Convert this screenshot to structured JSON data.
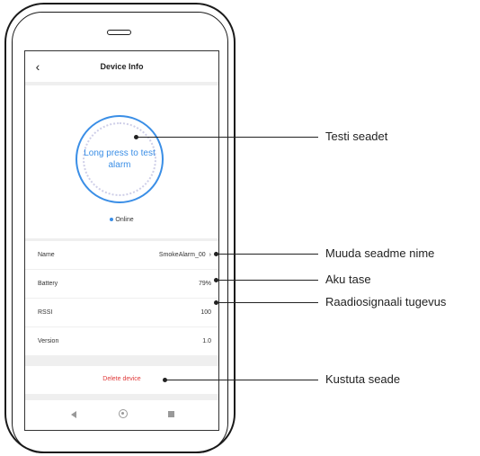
{
  "app": {
    "title": "Device Info",
    "back_icon": "‹"
  },
  "device": {
    "test_button_label": "Long press to test alarm",
    "status": "Online",
    "rows": [
      {
        "label": "Name",
        "value": "SmokeAlarm_00",
        "chevron": "›"
      },
      {
        "label": "Battery",
        "value": "79%"
      },
      {
        "label": "RSSI",
        "value": "100"
      },
      {
        "label": "Version",
        "value": "1.0"
      }
    ],
    "delete_label": "Delete device"
  },
  "annotations": {
    "test": "Testi seadet",
    "rename": "Muuda seadme nime",
    "battery": "Aku tase",
    "rssi": "Raadiosignaali tugevus",
    "delete": "Kustuta seade"
  },
  "colors": {
    "accent": "#3a8ee6",
    "danger": "#e03b3b"
  }
}
